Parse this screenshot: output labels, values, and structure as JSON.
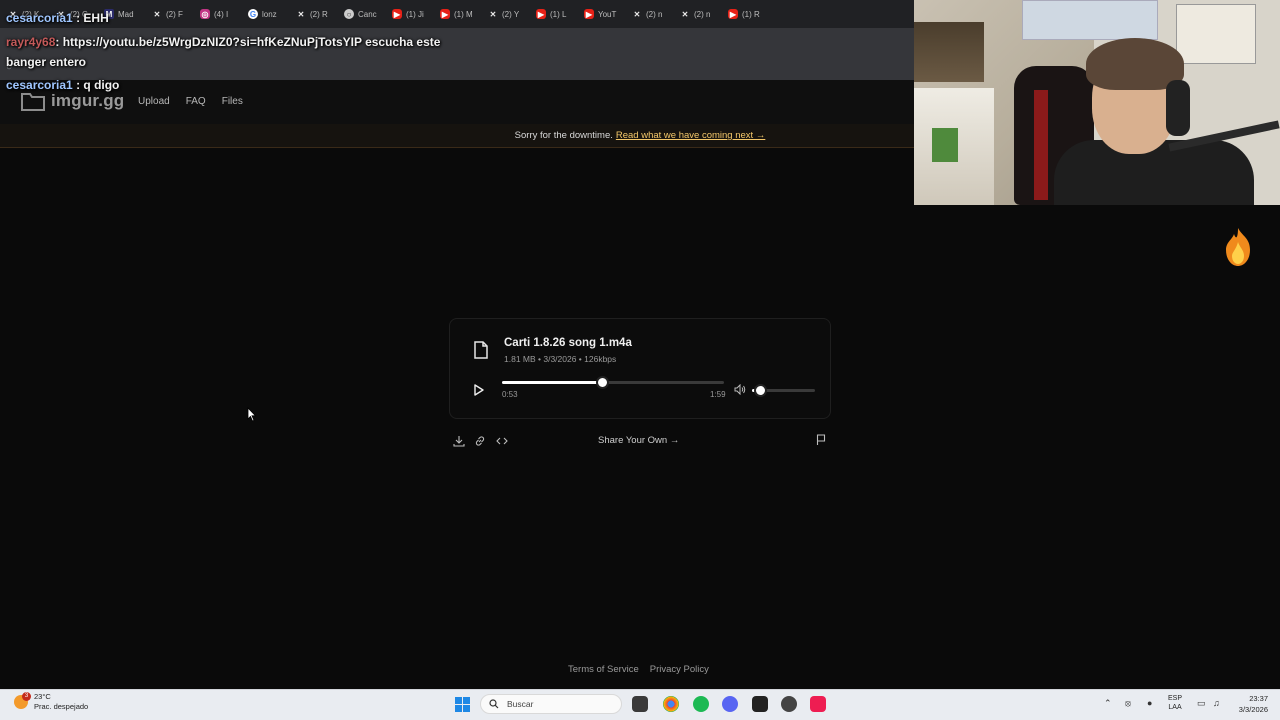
{
  "browser": {
    "tabs": [
      {
        "icon": "x",
        "label": "(2) K"
      },
      {
        "icon": "x",
        "label": "(2) C"
      },
      {
        "icon": "m",
        "label": "Mad"
      },
      {
        "icon": "x",
        "label": "(2) F"
      },
      {
        "icon": "ig",
        "label": "(4) I"
      },
      {
        "icon": "g",
        "label": "lonz"
      },
      {
        "icon": "x",
        "label": "(2) R"
      },
      {
        "icon": "c",
        "label": "Canc"
      },
      {
        "icon": "yt",
        "label": "(1) Ji"
      },
      {
        "icon": "yt",
        "label": "(1) M"
      },
      {
        "icon": "x",
        "label": "(2) Y"
      },
      {
        "icon": "yt",
        "label": "(1) L"
      },
      {
        "icon": "yt",
        "label": "YouT"
      },
      {
        "icon": "x",
        "label": "(2) n"
      },
      {
        "icon": "x",
        "label": "(2) n"
      },
      {
        "icon": "yt",
        "label": "(1) R"
      }
    ]
  },
  "chat": {
    "msg1": {
      "user": "cesarcoria1",
      "text": " : EHH"
    },
    "msg2": {
      "user": "rayr4y68",
      "text": ": https://youtu.be/z5WrgDzNIZ0?si=hfKeZNuPjTotsYIP escucha este"
    },
    "msg2b": "banger entero",
    "msg3": {
      "user": "cesarcoria1",
      "text": " : q digo"
    }
  },
  "site": {
    "logo": "imgur.gg",
    "nav": [
      "Upload",
      "FAQ",
      "Files"
    ],
    "banner": {
      "text": "Sorry for the downtime.",
      "link": "Read what we have coming next →"
    }
  },
  "player": {
    "title": "Carti 1.8.26 song 1.m4a",
    "meta": "1.81 MB • 3/3/2026 • 126kbps",
    "current_time": "0:53",
    "total_time": "1:59",
    "progress_fraction": 0.45,
    "volume_fraction": 0.12
  },
  "actions": {
    "share_label": "Share Your Own →"
  },
  "footer": {
    "terms": "Terms of Service",
    "privacy": "Privacy Policy"
  },
  "taskbar": {
    "weather_temp": "23°C",
    "weather_desc": "Prac. despejado",
    "weather_badge": "3",
    "search_placeholder": "Buscar",
    "lang_line1": "ESP",
    "lang_line2": "LAA",
    "time": "23:37",
    "date": "3/3/2026"
  },
  "colors": {
    "accent_link": "#f4c86a",
    "youtube": "#e62117",
    "spotify": "#1db954",
    "discord": "#5865f2",
    "tiktok": "#ee1d52"
  }
}
